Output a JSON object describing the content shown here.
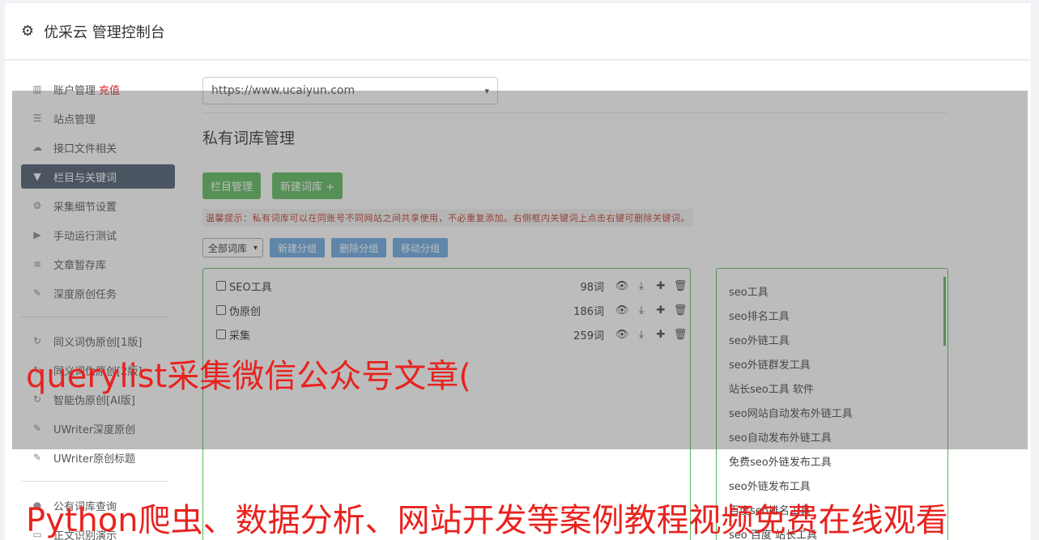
{
  "header": {
    "title": "优采云 管理控制台"
  },
  "sidebar": {
    "group1": [
      {
        "label": "账户管理",
        "extra": "充值",
        "icon": "bar-chart-icon"
      },
      {
        "label": "站点管理",
        "icon": "server-icon"
      },
      {
        "label": "接口文件相关",
        "icon": "cloud-upload-icon"
      },
      {
        "label": "栏目与关键词",
        "icon": "filter-icon",
        "active": true
      },
      {
        "label": "采集细节设置",
        "icon": "cogs-icon"
      },
      {
        "label": "手动运行测试",
        "icon": "play-circle-icon"
      },
      {
        "label": "文章暂存库",
        "icon": "database-icon"
      },
      {
        "label": "深度原创任务",
        "icon": "edit-icon"
      }
    ],
    "group2": [
      {
        "label": "同义词伪原创[1版]",
        "icon": "refresh-icon"
      },
      {
        "label": "同义词伪原创[2版]",
        "icon": "refresh-icon"
      },
      {
        "label": "智能伪原创[AI版]",
        "icon": "refresh-icon"
      },
      {
        "label": "UWriter深度原创",
        "icon": "edit-icon"
      },
      {
        "label": "UWriter原创标题",
        "icon": "edit-icon"
      }
    ],
    "group3": [
      {
        "label": "公有词库查询",
        "icon": "comment-icon"
      },
      {
        "label": "正文识别演示",
        "icon": "desktop-icon"
      }
    ]
  },
  "main": {
    "site_select": "https://www.ucaiyun.com",
    "section_title": "私有词库管理",
    "btn_column": "栏目管理",
    "btn_new_lib": "新建词库 +",
    "tip": "温馨提示：私有词库可以在同账号不同网站之间共享使用，不必重复添加。右侧框内关键词上点击右键可删除关键词。",
    "filter_select": "全部词库",
    "btn_new_group": "新建分组",
    "btn_delete_group": "删除分组",
    "btn_move_group": "移动分组",
    "libraries": [
      {
        "name": "SEO工具",
        "count": "98词"
      },
      {
        "name": "伪原创",
        "count": "186词"
      },
      {
        "name": "采集",
        "count": "259词"
      }
    ],
    "keywords": [
      "seo工具",
      "seo排名工具",
      "seo外链工具",
      "seo外链群发工具",
      "站长seo工具 软件",
      "seo网站自动发布外链工具",
      "seo自动发布外链工具",
      "免费seo外链发布工具",
      "seo外链发布工具",
      "百度seo排名工具",
      "seo 百度 站长工具"
    ]
  },
  "overlay": {
    "text1": "querylist采集微信公众号文章(",
    "text2": "Python爬虫、数据分析、网站开发等案例教程视频免费在线观看"
  },
  "colors": {
    "accent_green": "#5cb85c",
    "accent_blue": "#5bc0de",
    "overlay_text": "#e8231f",
    "sidebar_active": "#4a5a6f"
  }
}
